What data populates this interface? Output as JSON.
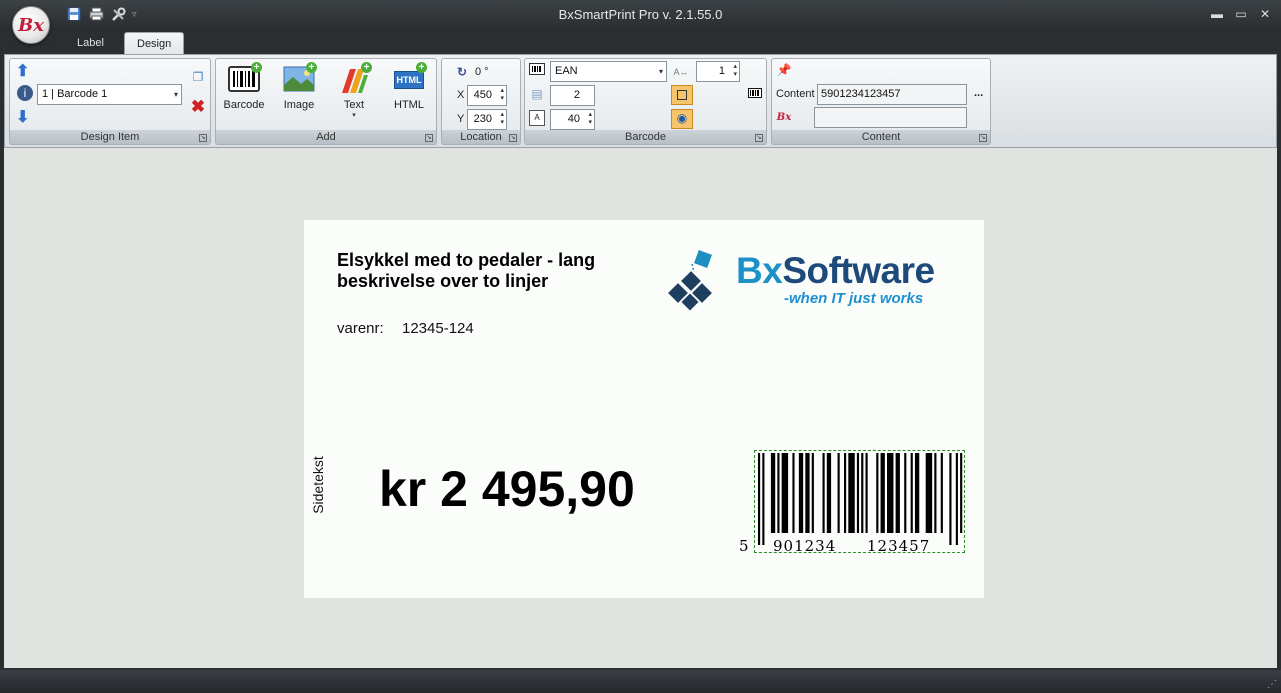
{
  "window": {
    "title": "BxSmartPrint Pro v. 2.1.55.0",
    "logo_text": "Bx"
  },
  "tabs": [
    {
      "label": "Label"
    },
    {
      "label": "Design"
    }
  ],
  "ribbon": {
    "design_item": {
      "group_label": "Design Item",
      "selected_item": "1 | Barcode 1"
    },
    "add": {
      "group_label": "Add",
      "buttons": [
        {
          "label": "Barcode"
        },
        {
          "label": "Image"
        },
        {
          "label": "Text"
        },
        {
          "label": "HTML"
        }
      ],
      "html_icon_text": "HTML"
    },
    "location": {
      "group_label": "Location",
      "rotation": "0 °",
      "x_label": "X",
      "x_value": "450",
      "y_label": "Y",
      "y_value": "230"
    },
    "barcode": {
      "group_label": "Barcode",
      "type": "EAN",
      "bar_width": "2",
      "height": "40",
      "ratio_value": "1"
    },
    "content": {
      "group_label": "Content",
      "content_label": "Content",
      "content_value": "5901234123457",
      "more": "...",
      "bx_value": ""
    }
  },
  "label": {
    "title": "Elsykkel med to pedaler - lang beskrivelse over to linjer",
    "varenr_label": "varenr:",
    "varenr_value": "12345-124",
    "side_text": "Sidetekst",
    "price": "kr 2 495,90",
    "brand": {
      "name_part1": "Bx",
      "name_part2": "Software",
      "slogan": "-when IT just works"
    },
    "barcode": {
      "first_digit": "5",
      "left_group": "901234",
      "right_group": "123457"
    }
  }
}
